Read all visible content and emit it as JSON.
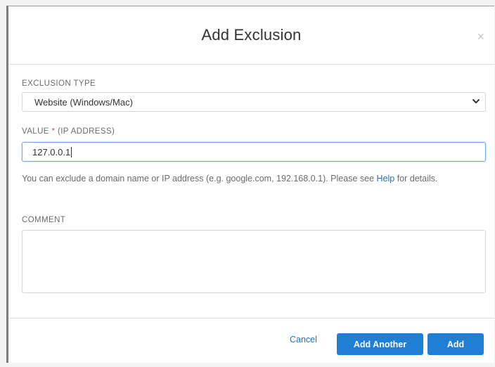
{
  "dialog": {
    "title": "Add Exclusion",
    "close_glyph": "×"
  },
  "exclusion_type": {
    "label": "EXCLUSION TYPE",
    "selected": "Website (Windows/Mac)",
    "icon": "chevron-down-icon"
  },
  "value_field": {
    "label": "VALUE",
    "required_mark": "*",
    "label_suffix": "(IP ADDRESS)",
    "value": "127.0.0.1"
  },
  "help": {
    "text_before": "You can exclude a domain name or IP address (e.g. google.com, 192.168.0.1). Please see ",
    "link": "Help",
    "text_after": " for details."
  },
  "comment": {
    "label": "COMMENT",
    "value": ""
  },
  "footer": {
    "cancel_label": "Cancel",
    "add_another_label": "Add Another",
    "add_label": "Add"
  },
  "colors": {
    "accent": "#1f7fd4",
    "link": "#1f73c2",
    "required": "#d9534f"
  }
}
